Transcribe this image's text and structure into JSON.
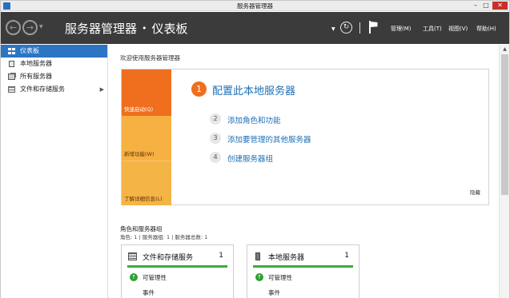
{
  "window": {
    "title": "服务器管理器",
    "minimize_glyph": "–",
    "maximize_glyph": "□",
    "close_glyph": "✕"
  },
  "header": {
    "breadcrumb_root": "服务器管理器",
    "breadcrumb_sep": "•",
    "breadcrumb_current": "仪表板",
    "menus": [
      "管理(M)",
      "工具(T)",
      "视图(V)",
      "帮助(H)"
    ],
    "icons": [
      "back-arrow-icon",
      "forward-arrow-icon",
      "refresh-icon",
      "notification-flag-icon"
    ]
  },
  "sidebar": {
    "items": [
      {
        "label": "仪表板",
        "icon": "dashboard-grid-icon",
        "active": true
      },
      {
        "label": "本地服务器",
        "icon": "server-icon"
      },
      {
        "label": "所有服务器",
        "icon": "servers-icon"
      },
      {
        "label": "文件和存储服务",
        "icon": "storage-icon",
        "has_submenu": true
      }
    ]
  },
  "welcome": {
    "title": "欢迎使用服务器管理器",
    "tiles": [
      "快速启动(Q)",
      "新增功能(W)",
      "了解详细信息(L)"
    ],
    "steps": [
      {
        "num": "1",
        "label": "配置此本地服务器"
      },
      {
        "num": "2",
        "label": "添加角色和功能"
      },
      {
        "num": "3",
        "label": "添加要管理的其他服务器"
      },
      {
        "num": "4",
        "label": "创建服务器组"
      }
    ],
    "hide": "隐藏"
  },
  "roles": {
    "title": "角色和服务器组",
    "summary": "角色: 1 | 服务器组: 1 | 服务器总数: 1",
    "cards": [
      {
        "title": "文件和存储服务",
        "count": "1",
        "manageability": "可管理性",
        "events": "事件"
      },
      {
        "title": "本地服务器",
        "count": "1",
        "manageability": "可管理性",
        "events": "事件"
      }
    ]
  },
  "colors": {
    "accent_orange": "#ef6f1e",
    "tile_yellow": "#f7b042",
    "header_bg": "#3b3b3b",
    "link_blue": "#1d6fb5",
    "status_green": "#3cac3c",
    "selection_blue": "#2c75c3"
  }
}
